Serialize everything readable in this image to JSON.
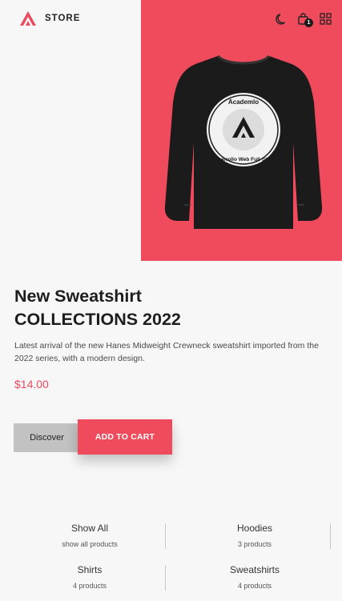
{
  "header": {
    "brand": "STORE",
    "cart_count": "1",
    "icons": [
      "store-logo-icon",
      "moon-icon",
      "shopping-bag-icon",
      "grid-icon"
    ]
  },
  "hero": {
    "title_line1": "New Sweatshirt",
    "title_line2": "COLLECTIONS 2022",
    "description": "Latest arrival of the new Hanes Midweight Crewneck sweatshirt imported from the 2022 series, with a modern design.",
    "price": "$14.00",
    "discover_label": "Discover",
    "add_to_cart_label": "ADD TO CART",
    "product_print_top": "Academlo",
    "product_print_bottom": "Desarrollo Web Full-Stack"
  },
  "categories": [
    {
      "name": "Show All",
      "sub": "show all products"
    },
    {
      "name": "Hoodies",
      "sub": "3 products"
    },
    {
      "name": "Shirts",
      "sub": "4 products"
    },
    {
      "name": "Sweatshirts",
      "sub": "4 products"
    }
  ],
  "colors": {
    "accent": "#ef4b5c",
    "price": "#e84a5f",
    "background": "#f7f7f7",
    "discover_button": "#c2c2c2"
  }
}
